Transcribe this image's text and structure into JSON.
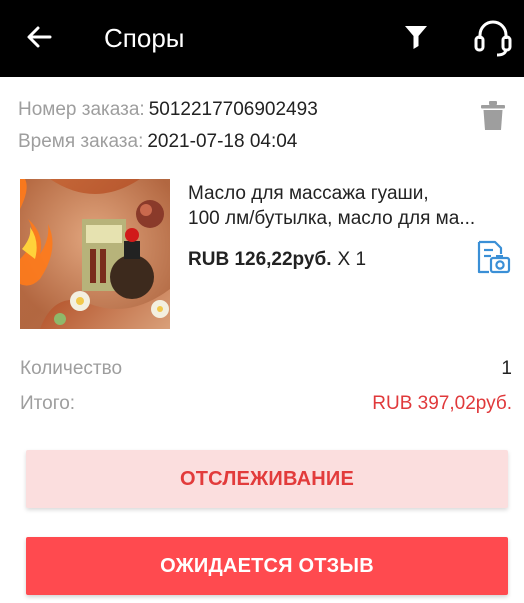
{
  "appbar": {
    "title": "Споры",
    "icons": {
      "back": "arrow-left-icon",
      "filter": "funnel-icon",
      "support": "headset-icon"
    }
  },
  "order": {
    "number_label": "Номер заказа:",
    "number_value": "5012217706902493",
    "time_label": "Время заказа:",
    "time_value": "2021-07-18 04:04",
    "delete_icon": "trash-icon"
  },
  "product": {
    "title_line1": "Масло для массажа гуаши,",
    "title_line2": "100 лм/бутылка, масло для ма...",
    "price": "RUB 126,22руб.",
    "quantity": "X 1",
    "snapshot_icon": "document-camera-icon"
  },
  "summary": {
    "quantity_label": "Количество",
    "quantity_value": "1",
    "total_label": "Итого:",
    "total_value": "RUB 397,02руб."
  },
  "buttons": {
    "track": "ОТСЛЕЖИВАНИЕ",
    "review": "ОЖИДАЕТСЯ ОТЗЫВ"
  },
  "colors": {
    "appbar": "#000000",
    "accent_red": "#e0393b",
    "track_bg": "#fbdede",
    "review_bg": "#ff4a4f",
    "icon_blue": "#3a8fd6"
  }
}
